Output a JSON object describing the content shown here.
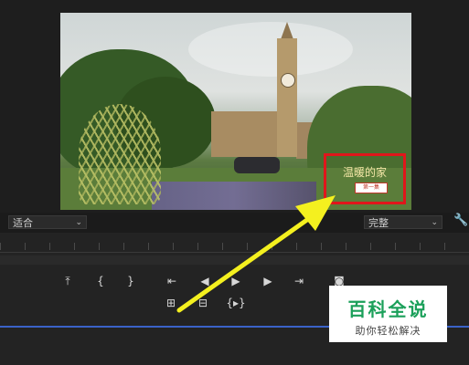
{
  "video_overlay": {
    "title": "温暖的家",
    "subtitle": "第一集"
  },
  "controls": {
    "zoom_select": {
      "value": "适合"
    },
    "quality_select": {
      "value": "完整"
    },
    "settings_icon": "wrench-icon"
  },
  "transport": {
    "row1": [
      {
        "name": "export-frame-icon",
        "glyph": "⤒"
      },
      {
        "name": "mark-in-icon",
        "glyph": "{"
      },
      {
        "name": "mark-out-icon",
        "glyph": "}"
      },
      {
        "name": "go-to-in-icon",
        "glyph": "⇤"
      },
      {
        "name": "step-back-icon",
        "glyph": "◀"
      },
      {
        "name": "play-icon",
        "glyph": "▶"
      },
      {
        "name": "step-forward-icon",
        "glyph": "▶"
      },
      {
        "name": "go-to-out-icon",
        "glyph": "⇥"
      },
      {
        "name": "camera-icon",
        "glyph": "◙"
      }
    ],
    "row2": [
      {
        "name": "insert-icon",
        "glyph": "⊞"
      },
      {
        "name": "overwrite-icon",
        "glyph": "⊟"
      },
      {
        "name": "trim-icon",
        "glyph": "{▸}"
      }
    ]
  },
  "watermark": {
    "title": "百科全说",
    "subtitle": "助你轻松解决"
  },
  "colors": {
    "highlight_box": "#e0161b",
    "arrow": "#f4f01f",
    "badge_green": "#1ba05a",
    "timeline_blue": "#3a62c8"
  }
}
